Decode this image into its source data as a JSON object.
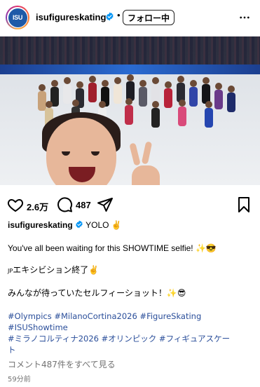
{
  "post": {
    "author": "isufigureskating",
    "avatar_text": "ISU",
    "separator": "•",
    "follow_label": "フォロー中",
    "likes": "2.6万",
    "comments": "487",
    "caption": {
      "username": "isufigureskating",
      "headline": "YOLO ✌️",
      "line1": "You've all been waiting for this SHOWTIME selfie! ✨😎",
      "line2_flag": "JP",
      "line2": "エキシビション終了✌️",
      "line3": "みんなが待っていたセルフィーショット！✨😎",
      "hashtags_line1": "#Olympics #MilanoCortina2026 #FigureSkating",
      "hashtags_line2": "#ISUShowtime",
      "hashtags_line3": "#ミラノコルティナ2026 #オリンピック #フィギュアスケー",
      "hashtags_line4": "ト"
    },
    "view_comments": "コメント487件をすべて見る",
    "timestamp": "59分前"
  },
  "colors": {
    "hashtag": "#2a4e9a",
    "muted": "#737373",
    "verified": "#0095f6"
  },
  "icons": [
    "verified-badge-icon",
    "more-options-icon",
    "heart-icon",
    "comment-icon",
    "share-icon",
    "bookmark-icon",
    "user-tag-icon"
  ]
}
